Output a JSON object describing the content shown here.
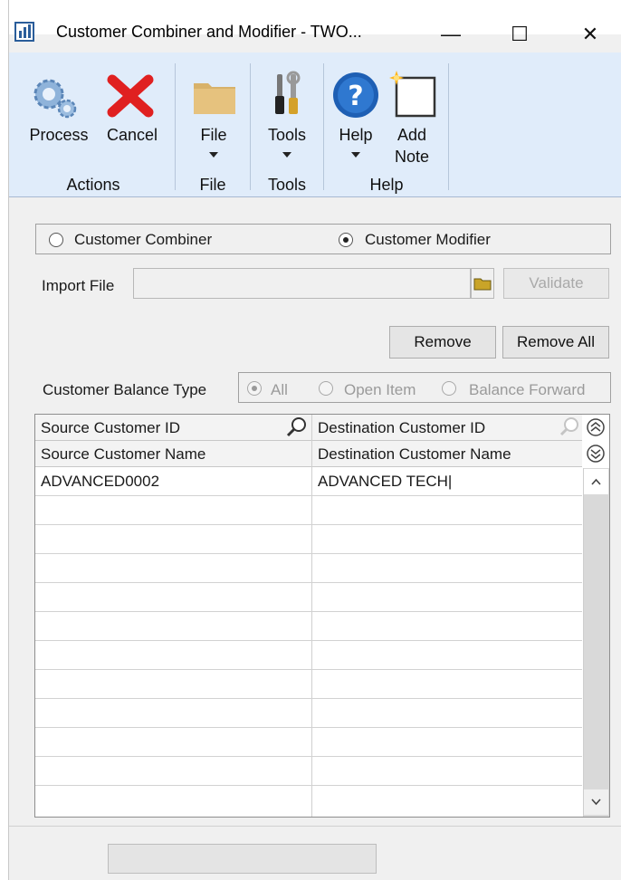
{
  "window": {
    "title": "Customer Combiner and Modifier  -  TWO...",
    "minimize": "—",
    "maximize": "☐",
    "close": "✕"
  },
  "ribbon": {
    "buttons": {
      "process": "Process",
      "cancel": "Cancel",
      "file": "File",
      "tools": "Tools",
      "help": "Help",
      "add_note_1": "Add",
      "add_note_2": "Note"
    },
    "groups": {
      "actions": "Actions",
      "file": "File",
      "tools": "Tools",
      "help": "Help"
    }
  },
  "mode": {
    "combiner_label": "Customer Combiner",
    "modifier_label": "Customer Modifier",
    "selected": "Customer Modifier"
  },
  "import": {
    "label": "Import File",
    "value": "",
    "validate_label": "Validate"
  },
  "actions": {
    "remove_label": "Remove",
    "remove_all_label": "Remove All"
  },
  "balance_type": {
    "label": "Customer Balance Type",
    "options": [
      "All",
      "Open Item",
      "Balance Forward"
    ],
    "selected": "All"
  },
  "grid": {
    "headers": {
      "source_id": "Source Customer ID",
      "dest_id": "Destination Customer ID",
      "source_name": "Source Customer Name",
      "dest_name": "Destination Customer Name"
    },
    "rows": [
      {
        "source": "ADVANCED0002",
        "destination": "ADVANCED TECH|"
      }
    ]
  },
  "icons": {
    "app": "dynamics-gp-icon",
    "process": "gears-icon",
    "cancel": "red-x-icon",
    "file": "folder-icon",
    "tools": "tools-icon",
    "help": "help-question-icon",
    "note": "note-icon",
    "lookup": "magnifier-icon",
    "browse": "folder-icon",
    "expand": "double-chevron-up-icon",
    "collapse": "double-chevron-down-icon"
  },
  "colors": {
    "ribbon": "#e0ecfa",
    "cancel_red": "#e02020",
    "help_blue": "#1e5fb4"
  }
}
